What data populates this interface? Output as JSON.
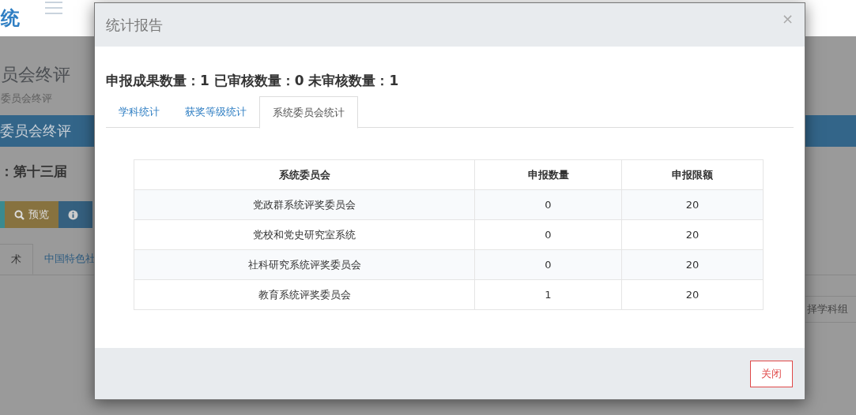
{
  "background": {
    "logo": "统",
    "page_title": "员会终评",
    "breadcrumb": "委员会终评",
    "section_bar": "委员会终评",
    "session": "：第十三届",
    "buttons": [
      {
        "kind": "plain"
      },
      {
        "label": "预览",
        "kind": "search"
      },
      {
        "kind": "info"
      }
    ],
    "tabs": [
      {
        "label": "术",
        "selected": true
      },
      {
        "label": "中国特色社",
        "selected": false
      }
    ],
    "group_select": "择学科组"
  },
  "modal": {
    "title": "统计报告",
    "close": "×",
    "summary": "申报成果数量：1 已审核数量：0 未审核数量：1",
    "tabs": [
      {
        "label": "学科统计",
        "selected": false
      },
      {
        "label": "获奖等级统计",
        "selected": false
      },
      {
        "label": "系统委员会统计",
        "selected": true
      }
    ],
    "table": {
      "columns": [
        "系统委员会",
        "申报数量",
        "申报限额"
      ],
      "rows": [
        [
          "党政群系统评奖委员会",
          "0",
          "20"
        ],
        [
          "党校和党史研究室系统",
          "0",
          "20"
        ],
        [
          "社科研究系统评奖委员会",
          "0",
          "20"
        ],
        [
          "教育系统评奖委员会",
          "1",
          "20"
        ]
      ]
    },
    "footer_button": "关闭"
  }
}
